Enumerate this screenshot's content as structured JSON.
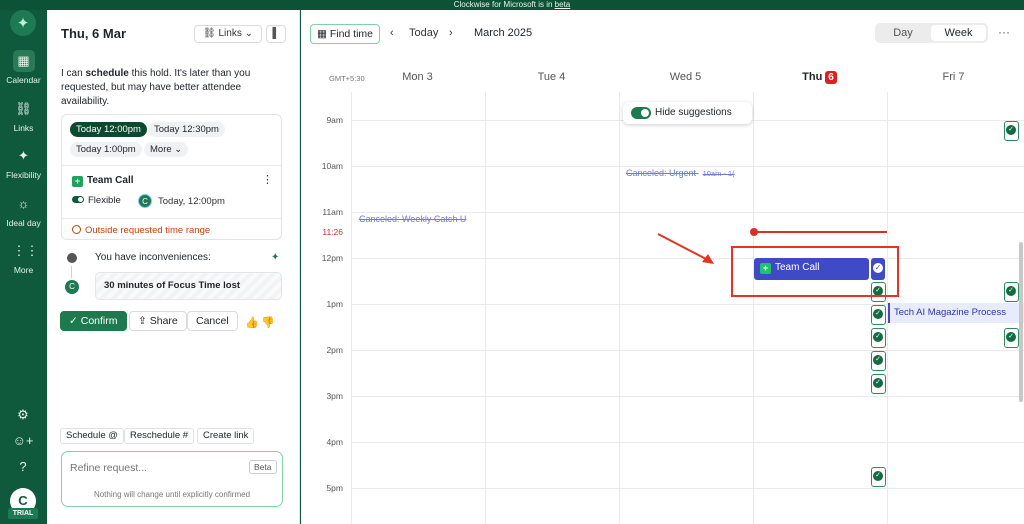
{
  "banner": {
    "prefix": "Clockwise for Microsoft is in ",
    "link": "beta"
  },
  "rail": {
    "logo_icon": "clockwise-logo-icon",
    "items": [
      {
        "label": "Calendar",
        "icon": "calendar-icon",
        "glyph": "▦",
        "active": true
      },
      {
        "label": "Links",
        "icon": "link-icon",
        "glyph": "⛓"
      },
      {
        "label": "Flexibility",
        "icon": "sparkle-icon",
        "glyph": "✦"
      },
      {
        "label": "Ideal day",
        "icon": "sun-icon",
        "glyph": "☼"
      },
      {
        "label": "More",
        "icon": "grid-icon",
        "glyph": "⋮⋮"
      }
    ],
    "avatar_initial": "C",
    "trial_label": "TRIAL"
  },
  "panel": {
    "date": "Thu, 6 Mar",
    "links_label": "Links",
    "message_pre": "I can ",
    "message_bold": "schedule",
    "message_post": " this hold. It's later than you requested, but may have better attendee availability.",
    "time_options": [
      "Today 12:00pm",
      "Today 12:30pm",
      "Today 1:00pm"
    ],
    "more_label": "More",
    "event": {
      "title": "Team Call",
      "flexible_label": "Flexible",
      "attendee_initial": "C",
      "time": "Today, 12:00pm",
      "warning": "Outside requested time range"
    },
    "inconvenience_heading": "You have inconveniences:",
    "inconvenience_item": "30 minutes of Focus Time lost",
    "inconvenience_initial": "C",
    "confirm_label": "Confirm",
    "share_label": "Share",
    "cancel_label": "Cancel",
    "quick_actions": [
      "Schedule @",
      "Reschedule #",
      "Create link"
    ],
    "refine_placeholder": "Refine request...",
    "beta_label": "Beta",
    "refine_note": "Nothing will change until explicitly confirmed"
  },
  "calendar": {
    "find_time_label": "Find time",
    "today_label": "Today",
    "month_label": "March 2025",
    "view_day": "Day",
    "view_week": "Week",
    "timezone": "GMT+5:30",
    "days": [
      {
        "label": "Mon 3"
      },
      {
        "label": "Tue 4"
      },
      {
        "label": "Wed 5"
      },
      {
        "label": "Thu",
        "badge": "6",
        "today": true
      },
      {
        "label": "Fri 7"
      }
    ],
    "hours": [
      "9am",
      "10am",
      "11am",
      "12pm",
      "1pm",
      "2pm",
      "3pm",
      "4pm",
      "5pm"
    ],
    "now_time": "11:26",
    "hide_suggestions_label": "Hide suggestions",
    "canceled_events": [
      {
        "title": "Canceled: Weekly Catch U"
      },
      {
        "title": "Canceled: Urgent",
        "time": "10am - 1("
      }
    ],
    "team_call_title": "Team Call",
    "tech_event_title": "Tech AI Magazine Process"
  }
}
